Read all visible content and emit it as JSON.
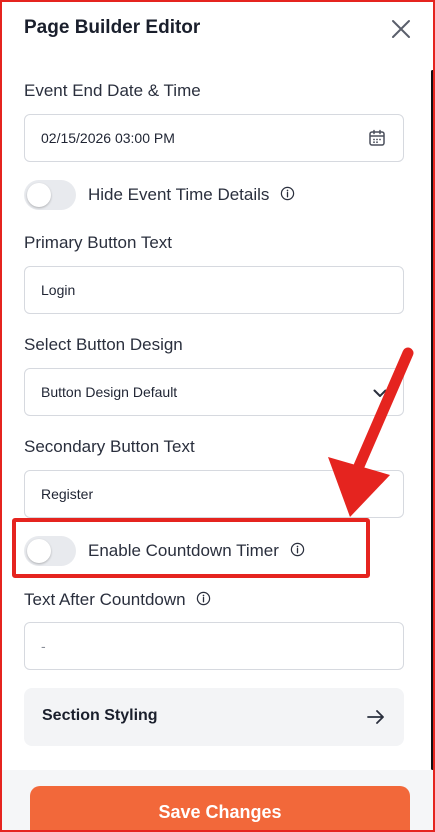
{
  "panel": {
    "title": "Page Builder Editor"
  },
  "fields": {
    "event_end": {
      "label": "Event End Date & Time",
      "value": "02/15/2026 03:00  PM"
    },
    "hide_time": {
      "label": "Hide Event Time Details",
      "enabled": false
    },
    "primary_btn": {
      "label": "Primary Button Text",
      "value": "Login"
    },
    "button_design": {
      "label": "Select Button Design",
      "value": "Button Design Default"
    },
    "secondary_btn": {
      "label": "Secondary Button Text",
      "value": "Register"
    },
    "countdown": {
      "label": "Enable Countdown Timer",
      "enabled": false
    },
    "after_countdown": {
      "label": "Text After Countdown",
      "value": "-"
    }
  },
  "section_styling": {
    "label": "Section Styling"
  },
  "footer": {
    "save_label": "Save Changes"
  },
  "colors": {
    "accent": "#f2683a",
    "annotation": "#e5241f"
  },
  "icons": {
    "close": "close-icon",
    "calendar": "calendar-icon",
    "info": "info-icon",
    "chevron": "chevron-down-icon",
    "arrow": "arrow-right-icon"
  }
}
